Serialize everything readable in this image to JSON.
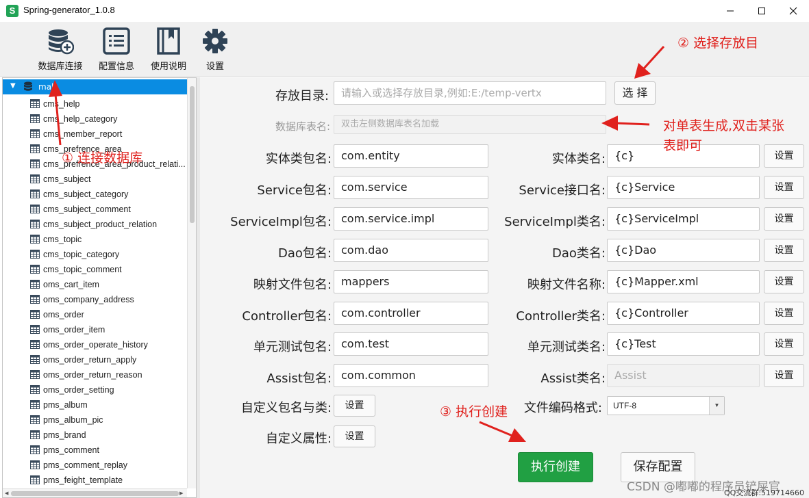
{
  "window": {
    "title": "Spring-generator_1.0.8",
    "logo_letter": "S",
    "controls": [
      "minimize",
      "maximize",
      "close"
    ]
  },
  "toolbar": [
    {
      "icon": "database-add-icon",
      "label": "数据库连接"
    },
    {
      "icon": "list-icon",
      "label": "配置信息"
    },
    {
      "icon": "book-icon",
      "label": "使用说明"
    },
    {
      "icon": "gear-icon",
      "label": "设置"
    }
  ],
  "tree": {
    "root": "mall",
    "items": [
      "cms_help",
      "cms_help_category",
      "cms_member_report",
      "cms_prefrence_area",
      "cms_prefrence_area_product_relati...",
      "cms_subject",
      "cms_subject_category",
      "cms_subject_comment",
      "cms_subject_product_relation",
      "cms_topic",
      "cms_topic_category",
      "cms_topic_comment",
      "oms_cart_item",
      "oms_company_address",
      "oms_order",
      "oms_order_item",
      "oms_order_operate_history",
      "oms_order_return_apply",
      "oms_order_return_reason",
      "oms_order_setting",
      "pms_album",
      "pms_album_pic",
      "pms_brand",
      "pms_comment",
      "pms_comment_replay",
      "pms_feight_template"
    ]
  },
  "form": {
    "dir": {
      "label": "存放目录:",
      "placeholder": "请输入或选择存放目录,例如:E:/temp-vertx",
      "button": "选 择"
    },
    "table": {
      "label": "数据库表名:",
      "placeholder": "双击左侧数据库表名加载"
    },
    "rows": [
      {
        "l_label": "实体类包名:",
        "l_value": "com.entity",
        "r_label": "实体类名:",
        "r_value": "{c}",
        "button": "设置"
      },
      {
        "l_label": "Service包名:",
        "l_value": "com.service",
        "r_label": "Service接口名:",
        "r_value": "{c}Service",
        "button": "设置"
      },
      {
        "l_label": "ServiceImpl包名:",
        "l_value": "com.service.impl",
        "r_label": "ServiceImpl类名:",
        "r_value": "{c}ServiceImpl",
        "button": "设置"
      },
      {
        "l_label": "Dao包名:",
        "l_value": "com.dao",
        "r_label": "Dao类名:",
        "r_value": "{c}Dao",
        "button": "设置"
      },
      {
        "l_label": "映射文件包名:",
        "l_value": "mappers",
        "r_label": "映射文件名称:",
        "r_value": "{c}Mapper.xml",
        "button": "设置"
      },
      {
        "l_label": "Controller包名:",
        "l_value": "com.controller",
        "r_label": "Controller类名:",
        "r_value": "{c}Controller",
        "button": "设置"
      },
      {
        "l_label": "单元测试包名:",
        "l_value": "com.test",
        "r_label": "单元测试类名:",
        "r_value": "{c}Test",
        "button": "设置"
      },
      {
        "l_label": "Assist包名:",
        "l_value": "com.common",
        "r_label": "Assist类名:",
        "r_value": "Assist",
        "button": "设置"
      }
    ],
    "custom_pkg": {
      "label": "自定义包名与类:",
      "button": "设置"
    },
    "custom_attr": {
      "label": "自定义属性:",
      "button": "设置"
    },
    "encoding": {
      "label": "文件编码格式:",
      "value": "UTF-8"
    },
    "create_button": "执行创建",
    "save_button": "保存配置"
  },
  "annotations": {
    "a1": "① 连接数据库",
    "a2": "② 选择存放目",
    "a3_line1": "对单表生成,双击某张",
    "a3_line2": "表即可",
    "a4": "③ 执行创建"
  },
  "watermark": {
    "csdn": "CSDN @嘟嘟的程序员铲屎官",
    "qq": "QQ交流群:519714660"
  },
  "colors": {
    "accent_blue": "#0a8ce2",
    "create_green": "#21a043",
    "annotation_red": "#e0211d",
    "icon_dark": "#2f4356"
  }
}
